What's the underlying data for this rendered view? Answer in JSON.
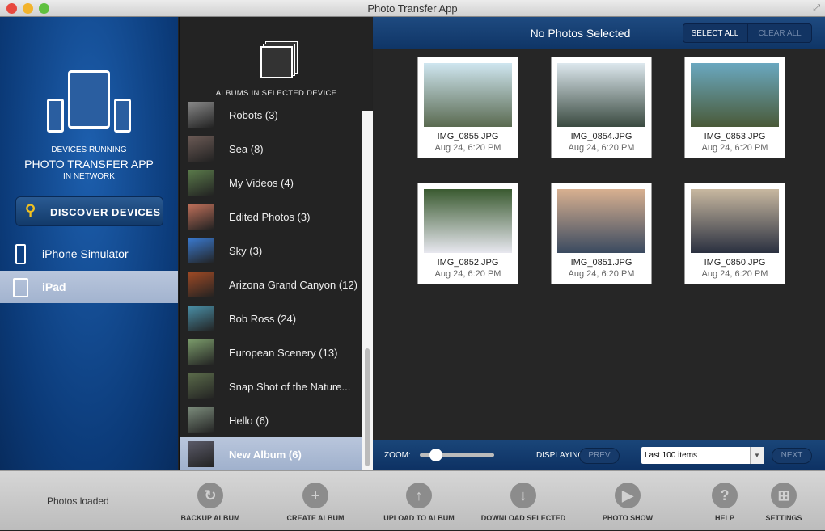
{
  "window": {
    "title": "Photo Transfer App"
  },
  "sidebar": {
    "line1": "DEVICES RUNNING",
    "line2": "PHOTO TRANSFER APP",
    "line3": "IN NETWORK",
    "discover_label": "DISCOVER DEVICES",
    "devices": [
      {
        "label": "iPhone Simulator",
        "selected": false
      },
      {
        "label": "iPad",
        "selected": true
      }
    ]
  },
  "albums": {
    "header": "ALBUMS IN SELECTED DEVICE",
    "items": [
      {
        "label": "Robots (3)",
        "thumb": "#888"
      },
      {
        "label": "Sea (8)",
        "thumb": "#6b5a55"
      },
      {
        "label": "My Videos (4)",
        "thumb": "#5a7a4a"
      },
      {
        "label": "Edited Photos (3)",
        "thumb": "#c0705a"
      },
      {
        "label": "Sky (3)",
        "thumb": "#3a7ad0"
      },
      {
        "label": "Arizona Grand Canyon (12)",
        "thumb": "#a04a25"
      },
      {
        "label": "Bob Ross (24)",
        "thumb": "#4a90a8"
      },
      {
        "label": "European Scenery (13)",
        "thumb": "#7a9a6a"
      },
      {
        "label": "Snap Shot of the Nature...",
        "thumb": "#5a6a4a"
      },
      {
        "label": "Hello (6)",
        "thumb": "#7a8a7a"
      },
      {
        "label": "New Album (6)",
        "thumb": "#5a5a68",
        "selected": true
      }
    ]
  },
  "main": {
    "status": "No Photos Selected",
    "select_all": "SELECT ALL",
    "clear_all": "CLEAR ALL",
    "photos": [
      {
        "name": "IMG_0855.JPG",
        "date": "Aug 24, 6:20 PM",
        "colors": [
          "#cfe6f0",
          "#5a6a50"
        ]
      },
      {
        "name": "IMG_0854.JPG",
        "date": "Aug 24, 6:20 PM",
        "colors": [
          "#dde8ee",
          "#3a4a40"
        ]
      },
      {
        "name": "IMG_0853.JPG",
        "date": "Aug 24, 6:20 PM",
        "colors": [
          "#6aa8c0",
          "#4a5a38"
        ]
      },
      {
        "name": "IMG_0852.JPG",
        "date": "Aug 24, 6:20 PM",
        "colors": [
          "#3a5a30",
          "#e8e8f0"
        ]
      },
      {
        "name": "IMG_0851.JPG",
        "date": "Aug 24, 6:20 PM",
        "colors": [
          "#d8b090",
          "#3a4a60"
        ]
      },
      {
        "name": "IMG_0850.JPG",
        "date": "Aug 24, 6:20 PM",
        "colors": [
          "#c8b8a0",
          "#2a3040"
        ]
      }
    ],
    "footer": {
      "zoom_label": "ZOOM:",
      "zoom_value": 0.15,
      "displaying_label": "DISPLAYING:",
      "prev": "PREV",
      "next": "NEXT",
      "display_select": "Last 100 items"
    }
  },
  "toolbar": {
    "status": "Photos loaded",
    "buttons": [
      {
        "label": "BACKUP ALBUM",
        "icon": "backup-icon",
        "glyph": "↻"
      },
      {
        "label": "CREATE ALBUM",
        "icon": "plus-icon",
        "glyph": "+"
      },
      {
        "label": "UPLOAD TO ALBUM",
        "icon": "upload-icon",
        "glyph": "↑"
      },
      {
        "label": "DOWNLOAD SELECTED",
        "icon": "download-icon",
        "glyph": "↓"
      },
      {
        "label": "PHOTO SHOW",
        "icon": "play-icon",
        "glyph": "▶"
      },
      {
        "label": "HELP",
        "icon": "help-icon",
        "glyph": "?"
      },
      {
        "label": "SETTINGS",
        "icon": "settings-icon",
        "glyph": "⊞"
      }
    ]
  }
}
